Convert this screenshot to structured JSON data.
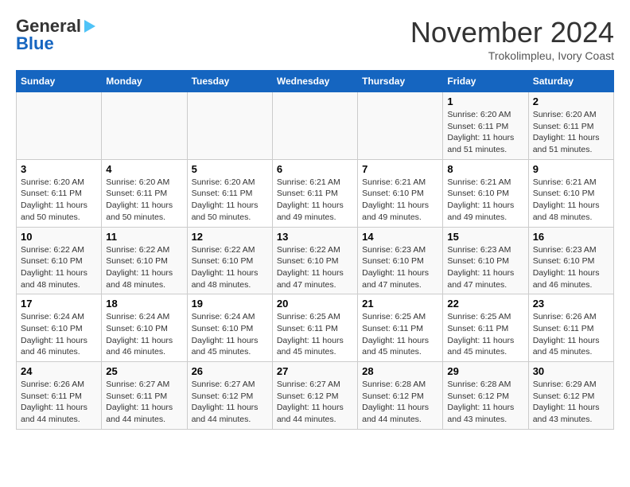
{
  "header": {
    "logo_line1": "General",
    "logo_line2": "Blue",
    "month": "November 2024",
    "location": "Trokolimpleu, Ivory Coast"
  },
  "days_of_week": [
    "Sunday",
    "Monday",
    "Tuesday",
    "Wednesday",
    "Thursday",
    "Friday",
    "Saturday"
  ],
  "weeks": [
    [
      {
        "day": "",
        "info": ""
      },
      {
        "day": "",
        "info": ""
      },
      {
        "day": "",
        "info": ""
      },
      {
        "day": "",
        "info": ""
      },
      {
        "day": "",
        "info": ""
      },
      {
        "day": "1",
        "info": "Sunrise: 6:20 AM\nSunset: 6:11 PM\nDaylight: 11 hours\nand 51 minutes."
      },
      {
        "day": "2",
        "info": "Sunrise: 6:20 AM\nSunset: 6:11 PM\nDaylight: 11 hours\nand 51 minutes."
      }
    ],
    [
      {
        "day": "3",
        "info": "Sunrise: 6:20 AM\nSunset: 6:11 PM\nDaylight: 11 hours\nand 50 minutes."
      },
      {
        "day": "4",
        "info": "Sunrise: 6:20 AM\nSunset: 6:11 PM\nDaylight: 11 hours\nand 50 minutes."
      },
      {
        "day": "5",
        "info": "Sunrise: 6:20 AM\nSunset: 6:11 PM\nDaylight: 11 hours\nand 50 minutes."
      },
      {
        "day": "6",
        "info": "Sunrise: 6:21 AM\nSunset: 6:11 PM\nDaylight: 11 hours\nand 49 minutes."
      },
      {
        "day": "7",
        "info": "Sunrise: 6:21 AM\nSunset: 6:10 PM\nDaylight: 11 hours\nand 49 minutes."
      },
      {
        "day": "8",
        "info": "Sunrise: 6:21 AM\nSunset: 6:10 PM\nDaylight: 11 hours\nand 49 minutes."
      },
      {
        "day": "9",
        "info": "Sunrise: 6:21 AM\nSunset: 6:10 PM\nDaylight: 11 hours\nand 48 minutes."
      }
    ],
    [
      {
        "day": "10",
        "info": "Sunrise: 6:22 AM\nSunset: 6:10 PM\nDaylight: 11 hours\nand 48 minutes."
      },
      {
        "day": "11",
        "info": "Sunrise: 6:22 AM\nSunset: 6:10 PM\nDaylight: 11 hours\nand 48 minutes."
      },
      {
        "day": "12",
        "info": "Sunrise: 6:22 AM\nSunset: 6:10 PM\nDaylight: 11 hours\nand 48 minutes."
      },
      {
        "day": "13",
        "info": "Sunrise: 6:22 AM\nSunset: 6:10 PM\nDaylight: 11 hours\nand 47 minutes."
      },
      {
        "day": "14",
        "info": "Sunrise: 6:23 AM\nSunset: 6:10 PM\nDaylight: 11 hours\nand 47 minutes."
      },
      {
        "day": "15",
        "info": "Sunrise: 6:23 AM\nSunset: 6:10 PM\nDaylight: 11 hours\nand 47 minutes."
      },
      {
        "day": "16",
        "info": "Sunrise: 6:23 AM\nSunset: 6:10 PM\nDaylight: 11 hours\nand 46 minutes."
      }
    ],
    [
      {
        "day": "17",
        "info": "Sunrise: 6:24 AM\nSunset: 6:10 PM\nDaylight: 11 hours\nand 46 minutes."
      },
      {
        "day": "18",
        "info": "Sunrise: 6:24 AM\nSunset: 6:10 PM\nDaylight: 11 hours\nand 46 minutes."
      },
      {
        "day": "19",
        "info": "Sunrise: 6:24 AM\nSunset: 6:10 PM\nDaylight: 11 hours\nand 45 minutes."
      },
      {
        "day": "20",
        "info": "Sunrise: 6:25 AM\nSunset: 6:11 PM\nDaylight: 11 hours\nand 45 minutes."
      },
      {
        "day": "21",
        "info": "Sunrise: 6:25 AM\nSunset: 6:11 PM\nDaylight: 11 hours\nand 45 minutes."
      },
      {
        "day": "22",
        "info": "Sunrise: 6:25 AM\nSunset: 6:11 PM\nDaylight: 11 hours\nand 45 minutes."
      },
      {
        "day": "23",
        "info": "Sunrise: 6:26 AM\nSunset: 6:11 PM\nDaylight: 11 hours\nand 45 minutes."
      }
    ],
    [
      {
        "day": "24",
        "info": "Sunrise: 6:26 AM\nSunset: 6:11 PM\nDaylight: 11 hours\nand 44 minutes."
      },
      {
        "day": "25",
        "info": "Sunrise: 6:27 AM\nSunset: 6:11 PM\nDaylight: 11 hours\nand 44 minutes."
      },
      {
        "day": "26",
        "info": "Sunrise: 6:27 AM\nSunset: 6:12 PM\nDaylight: 11 hours\nand 44 minutes."
      },
      {
        "day": "27",
        "info": "Sunrise: 6:27 AM\nSunset: 6:12 PM\nDaylight: 11 hours\nand 44 minutes."
      },
      {
        "day": "28",
        "info": "Sunrise: 6:28 AM\nSunset: 6:12 PM\nDaylight: 11 hours\nand 44 minutes."
      },
      {
        "day": "29",
        "info": "Sunrise: 6:28 AM\nSunset: 6:12 PM\nDaylight: 11 hours\nand 43 minutes."
      },
      {
        "day": "30",
        "info": "Sunrise: 6:29 AM\nSunset: 6:12 PM\nDaylight: 11 hours\nand 43 minutes."
      }
    ]
  ]
}
